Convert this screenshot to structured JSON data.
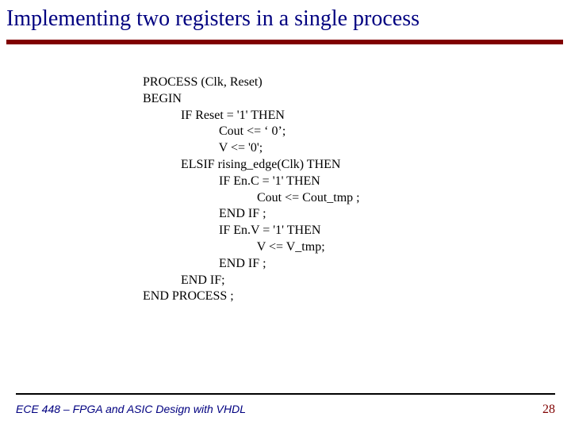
{
  "title": "Implementing two registers in a single process",
  "code": {
    "l1": "PROCESS (Clk, Reset)",
    "l2": "BEGIN",
    "l3": "IF Reset = '1' THEN",
    "l4": "Cout <= ‘ 0’;",
    "l5": "V <= '0';",
    "l6": "ELSIF rising_edge(Clk) THEN",
    "l7": "IF En.C = '1' THEN",
    "l8": "Cout <= Cout_tmp ;",
    "l9": "END IF ;",
    "l10": "IF En.V = '1' THEN",
    "l11": "V <= V_tmp;",
    "l12": "END IF ;",
    "l13": "END IF;",
    "l14": "END PROCESS ;"
  },
  "footer": {
    "left": "ECE 448 – FPGA and ASIC Design with VHDL",
    "slide_number": "28"
  }
}
